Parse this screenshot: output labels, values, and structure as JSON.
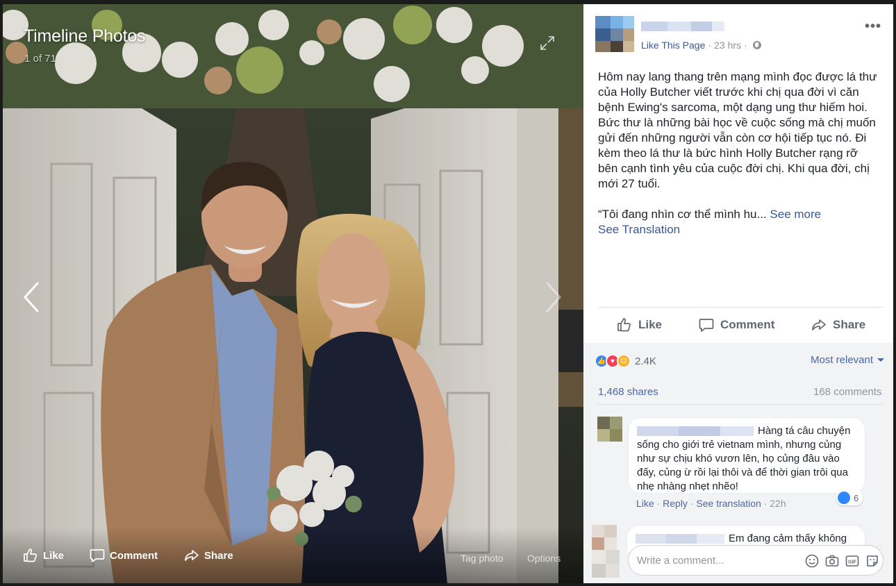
{
  "photo_viewer": {
    "title": "Timeline Photos",
    "counter": "1 of 71",
    "actions": {
      "like": "Like",
      "comment": "Comment",
      "share": "Share",
      "tag_photo": "Tag photo",
      "options": "Options"
    }
  },
  "post": {
    "like_page": "Like This Page",
    "time": "23 hrs",
    "text_paragraph": "Hôm nay lang thang trên mạng mình đọc được lá thư của Holly Butcher viết trước khi chị qua đời vì căn bệnh Ewing's sarcoma, một dạng ung thư hiếm hoi. Bức thư là những bài học về cuộc sống mà chị muốn gửi đến những người vẫn còn cơ hội tiếp tục nó. Đi kèm theo lá thư là bức hình Holly Butcher rạng rỡ bên cạnh tình yêu của cuộc đời chị. Khi qua đời, chị mới 27 tuổi.",
    "text_quote": "“Tôi đang nhìn cơ thể mình hu...",
    "see_more": "See more",
    "see_translation": "See Translation",
    "actions": {
      "like": "Like",
      "comment": "Comment",
      "share": "Share"
    }
  },
  "stats": {
    "reaction_count": "2.4K",
    "sort_label": "Most relevant",
    "shares": "1,468 shares",
    "comments": "168 comments"
  },
  "comments": [
    {
      "text": "Hàng tá câu chuyện sống cho giới trẻ vietnam mình, nhưng củng như sự chịu khó vươn lên, họ củng đâu vào đấy, củng ừ rồi lại thôi và để thời gian trôi qua nhẹ nhàng nhẹt nhẽo!",
      "like": "Like",
      "reply": "Reply",
      "see_translation": "See translation",
      "time": "22h",
      "reactions": "6"
    },
    {
      "text": "Em đang cảm thấy không"
    }
  ],
  "composer": {
    "placeholder": "Write a comment..."
  },
  "colors": {
    "link": "#385898",
    "reaction_like": "#2d88ff",
    "reaction_love": "#f33e58",
    "reaction_sad": "#f7b125"
  },
  "icons": [
    "expand-icon",
    "chevron-left-icon",
    "chevron-right-icon",
    "thumbs-up-icon",
    "comment-bubble-icon",
    "share-arrow-icon",
    "more-dots-icon",
    "globe-icon",
    "emoji-icon",
    "camera-icon",
    "gif-icon",
    "sticker-icon"
  ]
}
